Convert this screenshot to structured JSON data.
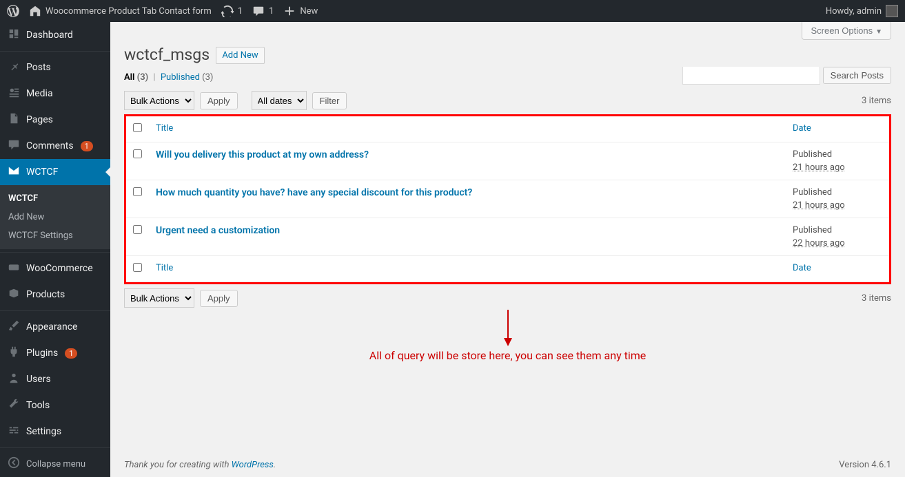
{
  "adminbar": {
    "site_name": "Woocommerce Product Tab Contact form",
    "refresh_count": "1",
    "comment_count": "1",
    "new_label": "New",
    "howdy": "Howdy, admin"
  },
  "sidebar": {
    "dashboard": "Dashboard",
    "posts": "Posts",
    "media": "Media",
    "pages": "Pages",
    "comments": "Comments",
    "comments_count": "1",
    "wctcf": "WCTCF",
    "wctcf_sub1": "WCTCF",
    "wctcf_sub2": "Add New",
    "wctcf_sub3": "WCTCF Settings",
    "woocommerce": "WooCommerce",
    "products": "Products",
    "appearance": "Appearance",
    "plugins": "Plugins",
    "plugins_count": "1",
    "users": "Users",
    "tools": "Tools",
    "settings": "Settings",
    "collapse": "Collapse menu"
  },
  "header": {
    "screen_options": "Screen Options",
    "page_title": "wctcf_msgs",
    "add_new": "Add New"
  },
  "filters": {
    "all_label": "All",
    "all_count": "(3)",
    "published_label": "Published",
    "published_count": "(3)"
  },
  "search": {
    "button": "Search Posts"
  },
  "bulk": {
    "label": "Bulk Actions",
    "apply": "Apply",
    "all_dates": "All dates",
    "filter": "Filter",
    "items_top": "3 items",
    "items_bottom": "3 items"
  },
  "table": {
    "col_title": "Title",
    "col_date": "Date",
    "rows": [
      {
        "title": "Will you delivery this product at my own address?",
        "status": "Published",
        "ago": "21 hours ago"
      },
      {
        "title": "How much quantity you have? have any special discount for this product?",
        "status": "Published",
        "ago": "21 hours ago"
      },
      {
        "title": "Urgent need a customization",
        "status": "Published",
        "ago": "22 hours ago"
      }
    ]
  },
  "annotation": "All of query will be store here, you can see them any time",
  "footer": {
    "pre": "Thank you for creating with ",
    "link": "WordPress",
    "dot": ".",
    "version": "Version 4.6.1"
  }
}
